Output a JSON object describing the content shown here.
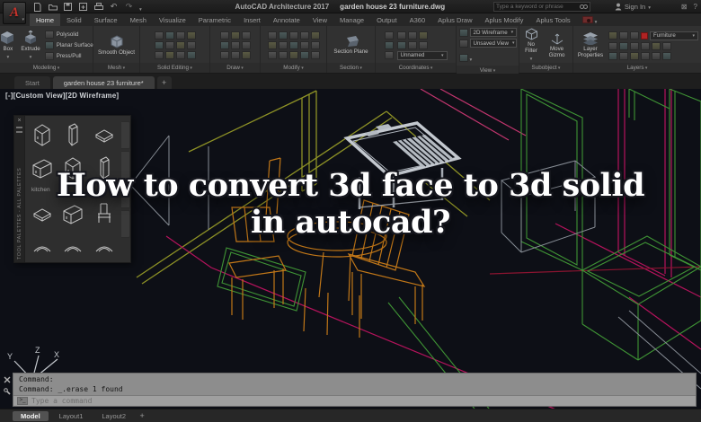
{
  "titlebar": {
    "product": "AutoCAD Architecture 2017",
    "filename": "garden house 23 furniture.dwg",
    "search_placeholder": "Type a keyword or phrase",
    "signin_label": "Sign In"
  },
  "ribbon": {
    "tabs": [
      "Home",
      "Solid",
      "Surface",
      "Mesh",
      "Visualize",
      "Parametric",
      "Insert",
      "Annotate",
      "View",
      "Manage",
      "Output",
      "A360",
      "Aplus Draw",
      "Aplus Modify",
      "Aplus Tools"
    ],
    "modeling": {
      "label": "Modeling",
      "box": "Box",
      "extrude": "Extrude",
      "polysolid": "Polysolid",
      "planar": "Planar Surface",
      "presspull": "Press/Pull"
    },
    "mesh": {
      "label": "Mesh",
      "smooth": "Smooth Object"
    },
    "solid_editing": {
      "label": "Solid Editing"
    },
    "draw": {
      "label": "Draw"
    },
    "modify": {
      "label": "Modify"
    },
    "section": {
      "label": "Section",
      "plane": "Section Plane"
    },
    "coordinates": {
      "label": "Coordinates",
      "ucs_name": "Unnamed"
    },
    "view": {
      "label": "View",
      "visual_style": "2D Wireframe",
      "named_view": "Unsaved View"
    },
    "subobject": {
      "label": "Subobject",
      "no_filter": "No Filter",
      "move_gizmo": "Move Gizmo"
    },
    "layers": {
      "label": "Layers",
      "properties": "Layer Properties",
      "current_layer": "Furniture",
      "swatch_color": "#b02323"
    }
  },
  "doc_tabs": {
    "start": "Start",
    "active": "garden house 23 furniture*",
    "add": "+"
  },
  "viewport": {
    "label": "[-][Custom View][2D Wireframe]"
  },
  "palette": {
    "title": "TOOL PALETTES - ALL PALETTES",
    "group_label": "kitchen"
  },
  "overlay": {
    "line1": "How to convert 3d face to 3d solid",
    "line2": "in autocad?"
  },
  "ucs": {
    "x": "X",
    "y": "Y",
    "z": "Z"
  },
  "command": {
    "history1": "Command:",
    "history2": "Command: _.erase 1 found",
    "placeholder": "Type a command"
  },
  "status": {
    "model": "Model",
    "layout1": "Layout1",
    "layout2": "Layout2",
    "add": "+"
  },
  "colors": {
    "canvas_bg": "#0d0f16",
    "wire_green": "#3f9435",
    "wire_olive": "#8e9226",
    "wire_magenta": "#b5135c",
    "wire_orange": "#c17718",
    "solid_table_gray": "#b4bac1"
  }
}
